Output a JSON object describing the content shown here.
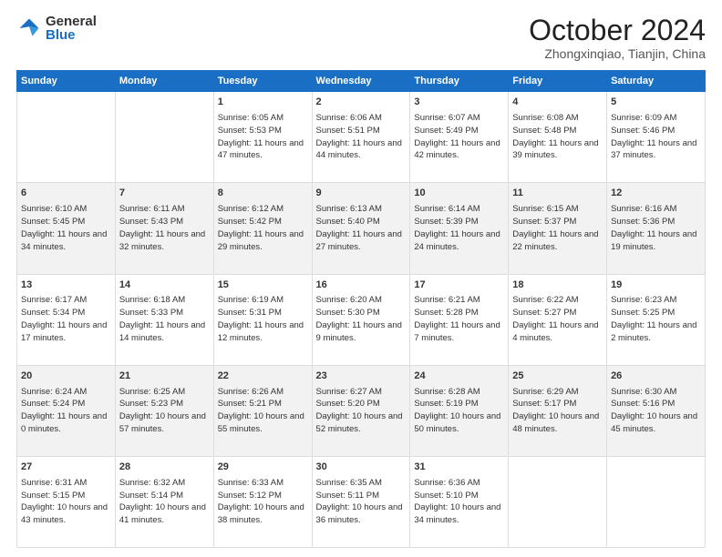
{
  "logo": {
    "general": "General",
    "blue": "Blue"
  },
  "header": {
    "month": "October 2024",
    "location": "Zhongxinqiao, Tianjin, China"
  },
  "weekdays": [
    "Sunday",
    "Monday",
    "Tuesday",
    "Wednesday",
    "Thursday",
    "Friday",
    "Saturday"
  ],
  "weeks": [
    [
      {
        "day": "",
        "text": ""
      },
      {
        "day": "",
        "text": ""
      },
      {
        "day": "1",
        "text": "Sunrise: 6:05 AM\nSunset: 5:53 PM\nDaylight: 11 hours and 47 minutes."
      },
      {
        "day": "2",
        "text": "Sunrise: 6:06 AM\nSunset: 5:51 PM\nDaylight: 11 hours and 44 minutes."
      },
      {
        "day": "3",
        "text": "Sunrise: 6:07 AM\nSunset: 5:49 PM\nDaylight: 11 hours and 42 minutes."
      },
      {
        "day": "4",
        "text": "Sunrise: 6:08 AM\nSunset: 5:48 PM\nDaylight: 11 hours and 39 minutes."
      },
      {
        "day": "5",
        "text": "Sunrise: 6:09 AM\nSunset: 5:46 PM\nDaylight: 11 hours and 37 minutes."
      }
    ],
    [
      {
        "day": "6",
        "text": "Sunrise: 6:10 AM\nSunset: 5:45 PM\nDaylight: 11 hours and 34 minutes."
      },
      {
        "day": "7",
        "text": "Sunrise: 6:11 AM\nSunset: 5:43 PM\nDaylight: 11 hours and 32 minutes."
      },
      {
        "day": "8",
        "text": "Sunrise: 6:12 AM\nSunset: 5:42 PM\nDaylight: 11 hours and 29 minutes."
      },
      {
        "day": "9",
        "text": "Sunrise: 6:13 AM\nSunset: 5:40 PM\nDaylight: 11 hours and 27 minutes."
      },
      {
        "day": "10",
        "text": "Sunrise: 6:14 AM\nSunset: 5:39 PM\nDaylight: 11 hours and 24 minutes."
      },
      {
        "day": "11",
        "text": "Sunrise: 6:15 AM\nSunset: 5:37 PM\nDaylight: 11 hours and 22 minutes."
      },
      {
        "day": "12",
        "text": "Sunrise: 6:16 AM\nSunset: 5:36 PM\nDaylight: 11 hours and 19 minutes."
      }
    ],
    [
      {
        "day": "13",
        "text": "Sunrise: 6:17 AM\nSunset: 5:34 PM\nDaylight: 11 hours and 17 minutes."
      },
      {
        "day": "14",
        "text": "Sunrise: 6:18 AM\nSunset: 5:33 PM\nDaylight: 11 hours and 14 minutes."
      },
      {
        "day": "15",
        "text": "Sunrise: 6:19 AM\nSunset: 5:31 PM\nDaylight: 11 hours and 12 minutes."
      },
      {
        "day": "16",
        "text": "Sunrise: 6:20 AM\nSunset: 5:30 PM\nDaylight: 11 hours and 9 minutes."
      },
      {
        "day": "17",
        "text": "Sunrise: 6:21 AM\nSunset: 5:28 PM\nDaylight: 11 hours and 7 minutes."
      },
      {
        "day": "18",
        "text": "Sunrise: 6:22 AM\nSunset: 5:27 PM\nDaylight: 11 hours and 4 minutes."
      },
      {
        "day": "19",
        "text": "Sunrise: 6:23 AM\nSunset: 5:25 PM\nDaylight: 11 hours and 2 minutes."
      }
    ],
    [
      {
        "day": "20",
        "text": "Sunrise: 6:24 AM\nSunset: 5:24 PM\nDaylight: 11 hours and 0 minutes."
      },
      {
        "day": "21",
        "text": "Sunrise: 6:25 AM\nSunset: 5:23 PM\nDaylight: 10 hours and 57 minutes."
      },
      {
        "day": "22",
        "text": "Sunrise: 6:26 AM\nSunset: 5:21 PM\nDaylight: 10 hours and 55 minutes."
      },
      {
        "day": "23",
        "text": "Sunrise: 6:27 AM\nSunset: 5:20 PM\nDaylight: 10 hours and 52 minutes."
      },
      {
        "day": "24",
        "text": "Sunrise: 6:28 AM\nSunset: 5:19 PM\nDaylight: 10 hours and 50 minutes."
      },
      {
        "day": "25",
        "text": "Sunrise: 6:29 AM\nSunset: 5:17 PM\nDaylight: 10 hours and 48 minutes."
      },
      {
        "day": "26",
        "text": "Sunrise: 6:30 AM\nSunset: 5:16 PM\nDaylight: 10 hours and 45 minutes."
      }
    ],
    [
      {
        "day": "27",
        "text": "Sunrise: 6:31 AM\nSunset: 5:15 PM\nDaylight: 10 hours and 43 minutes."
      },
      {
        "day": "28",
        "text": "Sunrise: 6:32 AM\nSunset: 5:14 PM\nDaylight: 10 hours and 41 minutes."
      },
      {
        "day": "29",
        "text": "Sunrise: 6:33 AM\nSunset: 5:12 PM\nDaylight: 10 hours and 38 minutes."
      },
      {
        "day": "30",
        "text": "Sunrise: 6:35 AM\nSunset: 5:11 PM\nDaylight: 10 hours and 36 minutes."
      },
      {
        "day": "31",
        "text": "Sunrise: 6:36 AM\nSunset: 5:10 PM\nDaylight: 10 hours and 34 minutes."
      },
      {
        "day": "",
        "text": ""
      },
      {
        "day": "",
        "text": ""
      }
    ]
  ]
}
